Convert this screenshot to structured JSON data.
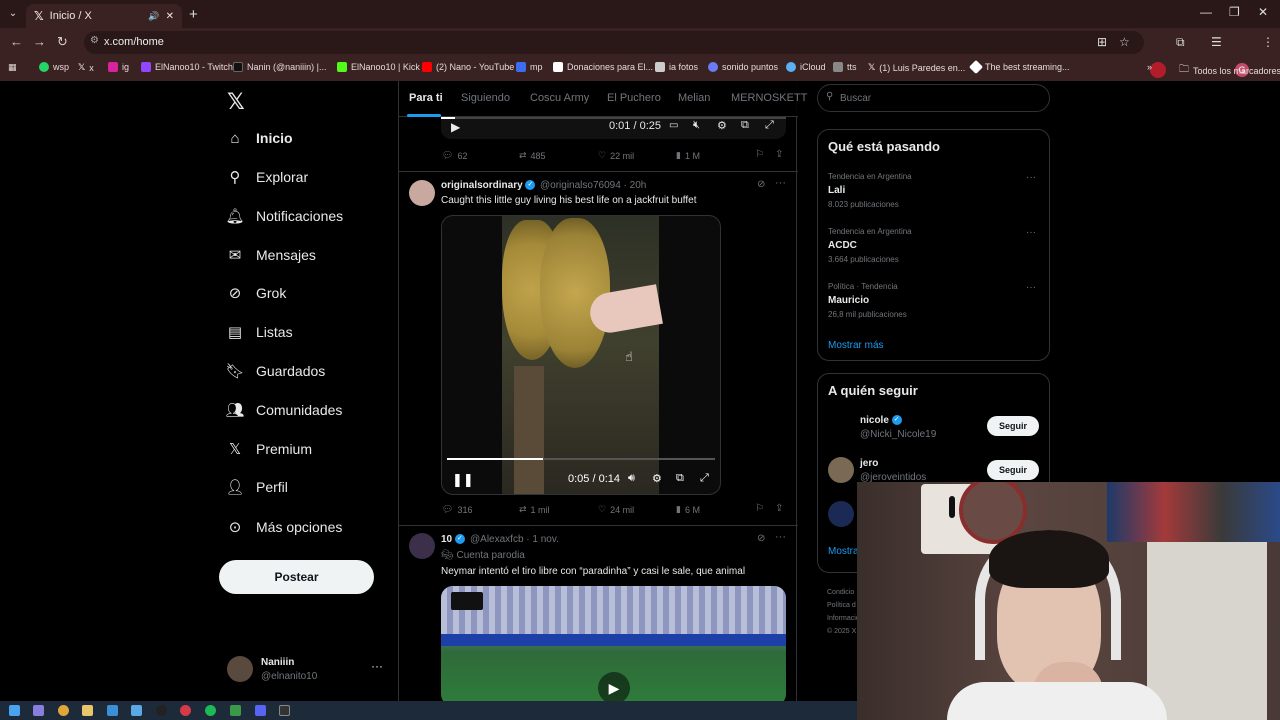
{
  "browser": {
    "tab_title": "Inicio / X",
    "url": "x.com/home",
    "bookmarks": [
      "wsp",
      "x",
      "ig",
      "ElNanoo10 - Twitch",
      "Nanin (@naniiin) |...",
      "ElNanoo10 | Kick",
      "(2) Nano - YouTube",
      "mp",
      "Donaciones para El...",
      "ia fotos",
      "sonido puntos",
      "iCloud",
      "tts",
      "(1) Luis Paredes en...",
      "The best streaming...",
      "Todos los marcadores"
    ]
  },
  "nav": {
    "logo": "X",
    "items": [
      {
        "label": "Inicio",
        "icon": "home-icon"
      },
      {
        "label": "Explorar",
        "icon": "search-icon"
      },
      {
        "label": "Notificaciones",
        "icon": "bell-icon"
      },
      {
        "label": "Mensajes",
        "icon": "mail-icon"
      },
      {
        "label": "Grok",
        "icon": "grok-icon"
      },
      {
        "label": "Listas",
        "icon": "list-icon"
      },
      {
        "label": "Guardados",
        "icon": "bookmark-icon"
      },
      {
        "label": "Comunidades",
        "icon": "people-icon"
      },
      {
        "label": "Premium",
        "icon": "x-icon"
      },
      {
        "label": "Perfil",
        "icon": "person-icon"
      },
      {
        "label": "Más opciones",
        "icon": "more-circle-icon"
      }
    ],
    "post_button": "Postear",
    "account_name": "Naniiin",
    "account_handle": "@elnanito10"
  },
  "feed": {
    "tabs": [
      "Para ti",
      "Siguiendo",
      "Coscu Army",
      "El Puchero",
      "Melian",
      "MERNOSKETT"
    ],
    "prev_tweet": {
      "time": "0:01 / 0:25",
      "replies": "62",
      "retweets": "485",
      "likes": "22 mil",
      "views": "1 M",
      "progress": 0.04
    },
    "tweet1": {
      "name": "originalsordinary",
      "handle": "@originalso76094",
      "time": "· 20h",
      "text": "Caught this little guy living his best life on a jackfruit buffet",
      "video_time": "0:05 / 0:14",
      "progress": 0.36,
      "replies": "316",
      "retweets": "1 mil",
      "likes": "24 mil",
      "views": "6 M"
    },
    "tweet2": {
      "name": "10",
      "handle": "@Alexaxfcb",
      "time": "· 1 nov.",
      "label": "Cuenta parodia",
      "text": "Neymar intentó el tiro libre con “paradinha” y casi le sale, que animal"
    }
  },
  "sidebar": {
    "search_placeholder": "Buscar",
    "trends_title": "Qué está pasando",
    "trends": [
      {
        "meta": "Tendencia en Argentina",
        "name": "Lali",
        "count": "8.023 publicaciones"
      },
      {
        "meta": "Tendencia en Argentina",
        "name": "ACDC",
        "count": "3.664 publicaciones"
      },
      {
        "meta": "Política · Tendencia",
        "name": "Mauricio",
        "count": "26,8 mil publicaciones"
      }
    ],
    "show_more": "Mostrar más",
    "follow_title": "A quién seguir",
    "follow": [
      {
        "name": "nicole",
        "handle": "@Nicki_Nicole19",
        "button": "Seguir"
      },
      {
        "name": "jero",
        "handle": "@jeroveintidos",
        "button": "Seguir"
      }
    ],
    "show_more_2": "Mostra",
    "footer": [
      "Condicio",
      "Política d",
      "Informació",
      "© 2025 X"
    ]
  },
  "colors": {
    "accent": "#1d9bf0",
    "chrome": "#3a2222"
  }
}
